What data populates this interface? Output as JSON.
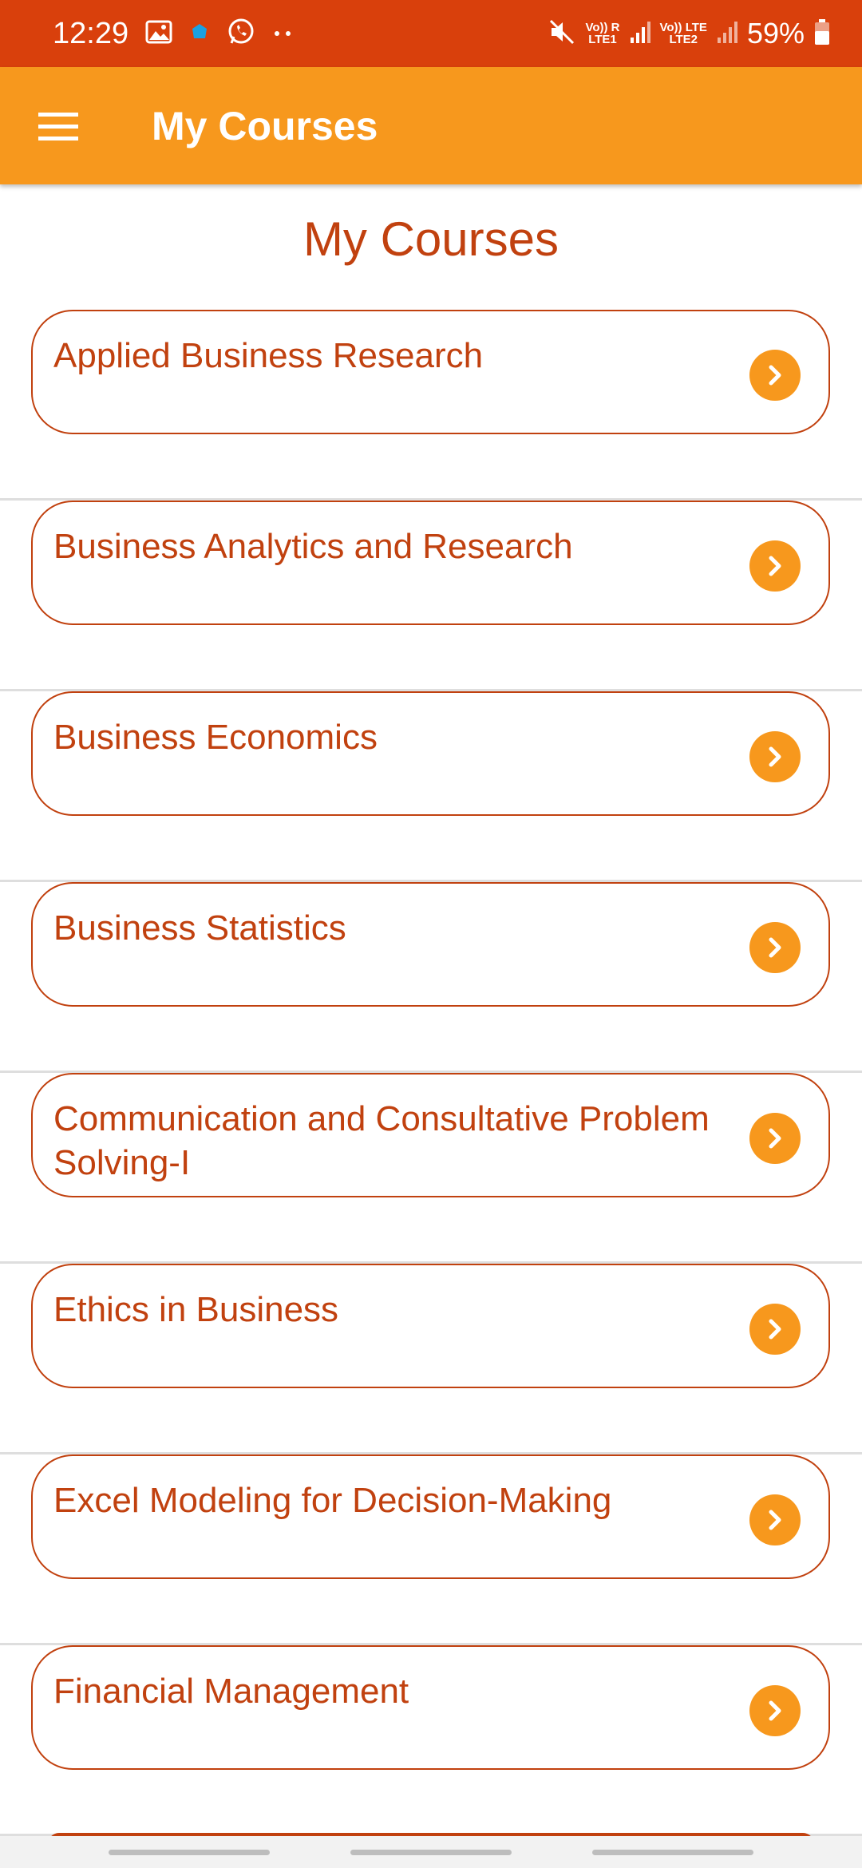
{
  "status_bar": {
    "time": "12:29",
    "left_icons": [
      "image-icon",
      "app-notification-icon",
      "whatsapp-icon",
      "more-dots-icon"
    ],
    "sim1_label": "Vo)) R",
    "sim1_net": "LTE1",
    "sim2_label": "Vo)) LTE",
    "sim2_net": "LTE2",
    "battery": "59%"
  },
  "app_bar": {
    "title": "My Courses",
    "menu_icon": "hamburger-menu-icon",
    "color": "#f7981d"
  },
  "page": {
    "heading": "My Courses",
    "accent_color": "#c1410f"
  },
  "courses": [
    {
      "label": "Applied Business Research"
    },
    {
      "label": "Business Analytics and Research"
    },
    {
      "label": "Business Economics"
    },
    {
      "label": "Business Statistics"
    },
    {
      "label": "Communication and Consultative Problem Solving-I"
    },
    {
      "label": "Ethics in Business"
    },
    {
      "label": "Excel Modeling for Decision-Making"
    },
    {
      "label": "Financial Management"
    }
  ]
}
